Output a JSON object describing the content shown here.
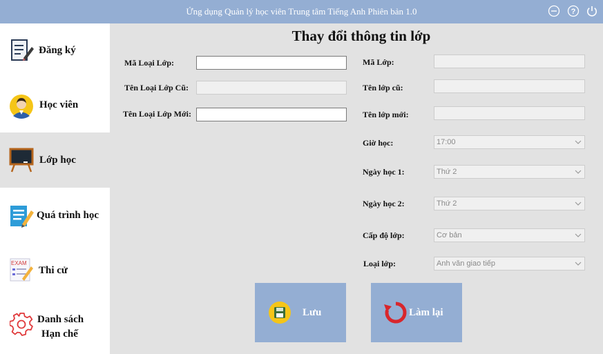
{
  "window": {
    "title": "Ứng dụng Quản lý học viên Trung tâm Tiếng Anh Phiên bản 1.0"
  },
  "sidebar": {
    "items": [
      {
        "label": "Đăng ký",
        "icon": "register-notebook-icon"
      },
      {
        "label": "Học viên",
        "icon": "student-avatar-icon"
      },
      {
        "label": "Lớp học",
        "icon": "blackboard-icon",
        "active": true
      },
      {
        "label": "Quá trình học",
        "icon": "checklist-pencil-icon"
      },
      {
        "label": "Thi cử",
        "icon": "exam-icon"
      },
      {
        "label_line1": "Danh sách",
        "label_line2": "Hạn chế",
        "icon": "gear-icon"
      }
    ]
  },
  "form": {
    "heading": "Thay đổi thông tin lớp",
    "class_type_code": {
      "label": "Mã Loại Lớp:",
      "value": ""
    },
    "old_class_type_name": {
      "label": "Tên Loại Lớp Cũ:",
      "value": ""
    },
    "new_class_type_name": {
      "label": "Tên Loại Lớp Mới:",
      "value": ""
    },
    "class_code": {
      "label": "Mã Lớp:",
      "value": ""
    },
    "old_class_name": {
      "label": "Tên lớp cũ:",
      "value": ""
    },
    "new_class_name": {
      "label": "Tên lớp mới:",
      "value": ""
    },
    "study_time": {
      "label": "Giờ học:",
      "value": "17:00"
    },
    "study_day_1": {
      "label": "Ngày học 1:",
      "value": "Thứ 2"
    },
    "study_day_2": {
      "label": "Ngày học 2:",
      "value": "Thứ 2"
    },
    "class_level": {
      "label": "Cấp độ lớp:",
      "value": "Cơ bản"
    },
    "class_type": {
      "label": "Loại lớp:",
      "value": "Anh văn giao tiếp"
    }
  },
  "actions": {
    "save_label": "Lưu",
    "reset_label": "Làm lại"
  },
  "colors": {
    "accent": "#94aed3",
    "background": "#e2e2e2",
    "sidebar": "#ffffff"
  }
}
